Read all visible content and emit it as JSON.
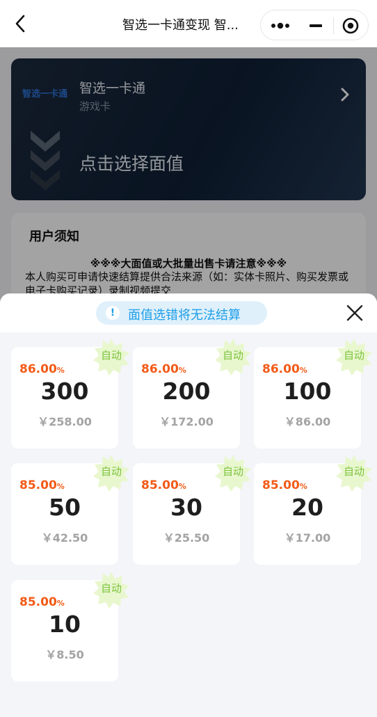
{
  "navbar": {
    "title": "智选一卡通变现 智...",
    "back_icon": "chevron-left-icon",
    "capsule": {
      "more_icon": "more-dots-icon",
      "minimize_icon": "minimize-icon",
      "close_icon": "target-circle-icon"
    }
  },
  "banner": {
    "logo_text": "智选一卡通",
    "card_name": "智选一卡通",
    "card_type": "游戏卡",
    "select_label": "点击选择面值"
  },
  "notice": {
    "title": "用户须知",
    "warning": "※※※大面值或大批量出售卡请注意※※※",
    "body": "本人购买可申请快速结算提供合法来源（如：实体卡照片、购买发票或电子卡购买记录）录制视频提交"
  },
  "sheet": {
    "tip_icon": "!",
    "tip_text": "面值选错将无法结算",
    "close_icon": "close-x-icon",
    "badge_text": "自动",
    "colors": {
      "rate": "#f25a16",
      "tip": "#1d9ee8",
      "badge_fill": "#e9f7cf",
      "badge_text": "#7cc33c"
    },
    "items": [
      {
        "rate": "86.00",
        "unit": "%",
        "face": "300",
        "price": "￥258.00"
      },
      {
        "rate": "86.00",
        "unit": "%",
        "face": "200",
        "price": "￥172.00"
      },
      {
        "rate": "86.00",
        "unit": "%",
        "face": "100",
        "price": "￥86.00"
      },
      {
        "rate": "85.00",
        "unit": "%",
        "face": "50",
        "price": "￥42.50"
      },
      {
        "rate": "85.00",
        "unit": "%",
        "face": "30",
        "price": "￥25.50"
      },
      {
        "rate": "85.00",
        "unit": "%",
        "face": "20",
        "price": "￥17.00"
      },
      {
        "rate": "85.00",
        "unit": "%",
        "face": "10",
        "price": "￥8.50"
      }
    ]
  }
}
